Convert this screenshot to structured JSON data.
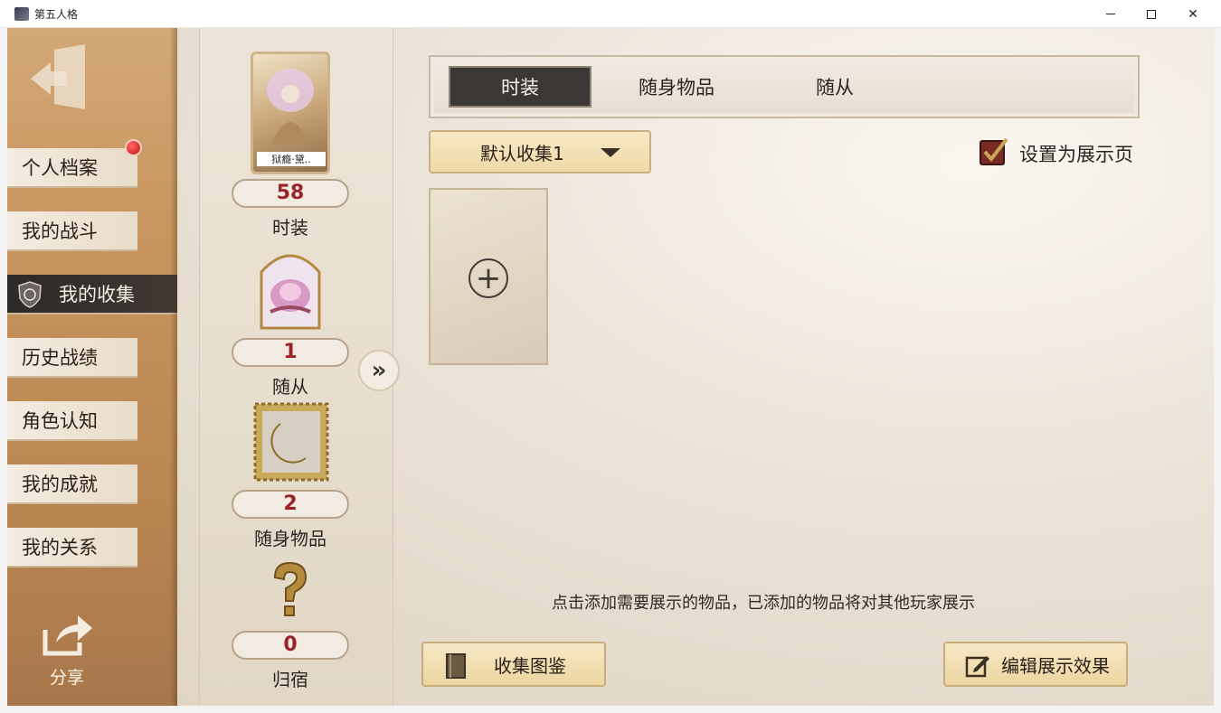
{
  "window": {
    "title": "第五人格"
  },
  "sidebar": {
    "items": [
      {
        "label": "个人档案"
      },
      {
        "label": "我的战斗"
      },
      {
        "label": "我的收集"
      },
      {
        "label": "历史战绩"
      },
      {
        "label": "角色认知"
      },
      {
        "label": "我的成就"
      },
      {
        "label": "我的关系"
      }
    ],
    "active_index": 2,
    "share_label": "分享"
  },
  "collection": {
    "costume": {
      "card_label": "狱瘾·黛..",
      "count": "58",
      "label": "时装"
    },
    "companion": {
      "count": "1",
      "label": "随从"
    },
    "accessory": {
      "count": "2",
      "label": "随身物品"
    },
    "residence": {
      "count": "0",
      "label": "归宿"
    }
  },
  "tabs": [
    {
      "label": "时装"
    },
    {
      "label": "随身物品"
    },
    {
      "label": "随从"
    }
  ],
  "active_tab": 0,
  "dropdown": {
    "value": "默认收集1"
  },
  "showcase": {
    "label": "设置为展示页",
    "checked": true
  },
  "hint": "点击添加需要展示的物品，已添加的物品将对其他玩家展示",
  "buttons": {
    "book": "收集图鉴",
    "edit": "编辑展示效果"
  },
  "colors": {
    "count_red": "#9a2228",
    "active_tab": "#3a3734",
    "gold_button": "#efd9a6"
  }
}
